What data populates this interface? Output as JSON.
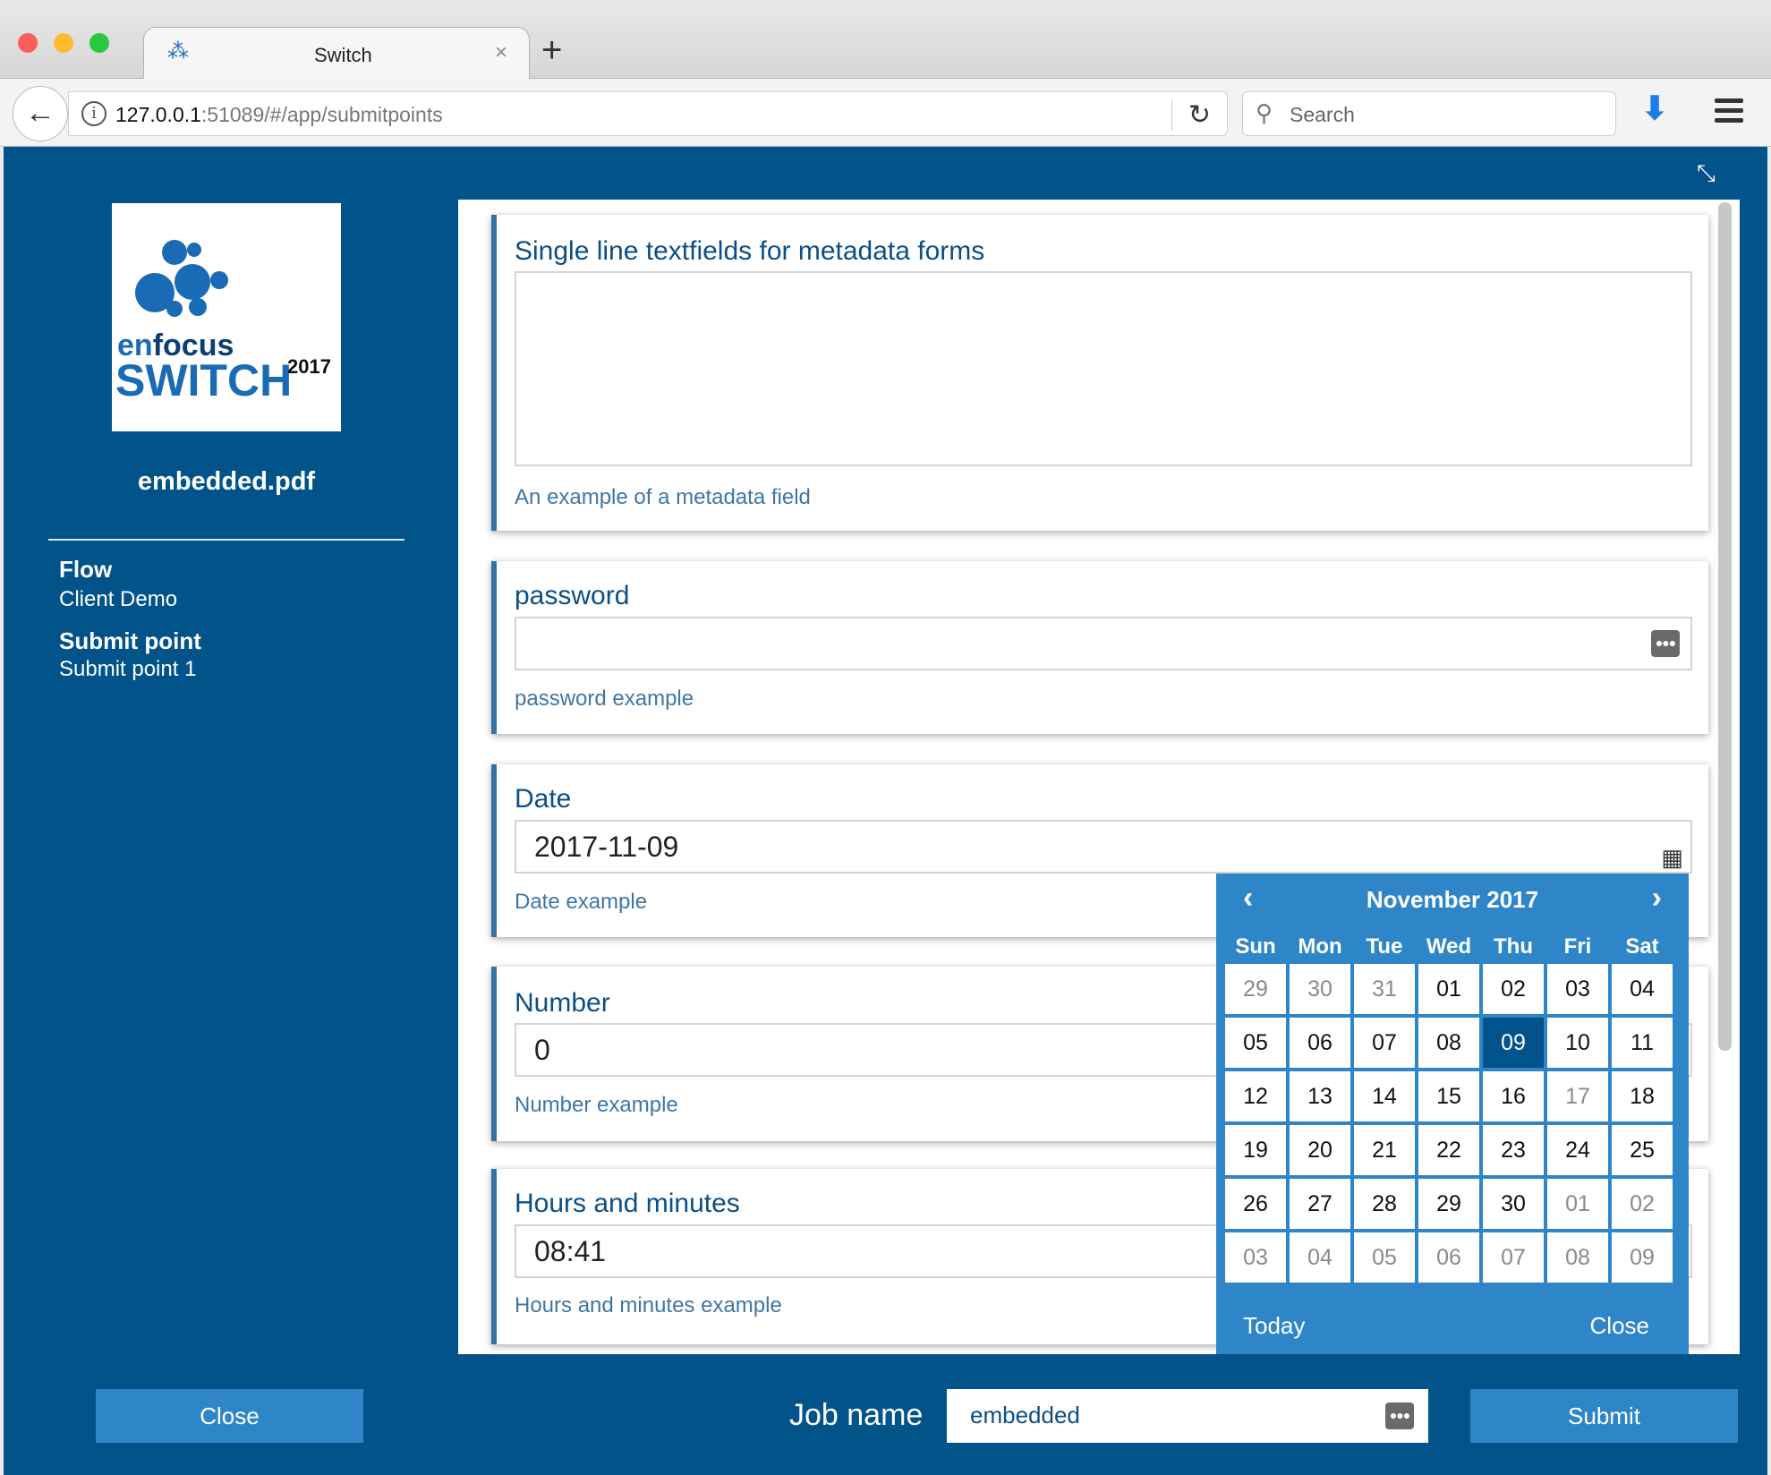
{
  "browser": {
    "tab_title": "Switch",
    "url_host": "127.0.0.1",
    "url_rest": ":51089/#/app/submitpoints",
    "search_placeholder": "Search"
  },
  "sidebar": {
    "file_name": "embedded.pdf",
    "flow_label": "Flow",
    "flow_value": "Client Demo",
    "submit_label": "Submit point",
    "submit_value": "Submit point 1",
    "logo_text": "enfocus SWITCH 2017"
  },
  "fields": [
    {
      "label": "Single line textfields for metadata forms",
      "value": "",
      "help": "An example of a metadata field"
    },
    {
      "label": "password",
      "value": "",
      "help": "password example"
    },
    {
      "label": "Date",
      "value": "2017-11-09",
      "help": "Date example"
    },
    {
      "label": "Number",
      "value": "0",
      "help": "Number example"
    },
    {
      "label": "Hours and minutes",
      "value": "08:41",
      "help": "Hours and minutes example"
    }
  ],
  "calendar": {
    "title": "November 2017",
    "weekdays": [
      "Sun",
      "Mon",
      "Tue",
      "Wed",
      "Thu",
      "Fri",
      "Sat"
    ],
    "days": [
      [
        "29",
        1
      ],
      [
        "30",
        1
      ],
      [
        "31",
        1
      ],
      [
        "01",
        0
      ],
      [
        "02",
        0
      ],
      [
        "03",
        0
      ],
      [
        "04",
        0
      ],
      [
        "05",
        0
      ],
      [
        "06",
        0
      ],
      [
        "07",
        0
      ],
      [
        "08",
        0
      ],
      [
        "09",
        2
      ],
      [
        "10",
        0
      ],
      [
        "11",
        0
      ],
      [
        "12",
        0
      ],
      [
        "13",
        0
      ],
      [
        "14",
        0
      ],
      [
        "15",
        0
      ],
      [
        "16",
        0
      ],
      [
        "17",
        1
      ],
      [
        "18",
        0
      ],
      [
        "19",
        0
      ],
      [
        "20",
        0
      ],
      [
        "21",
        0
      ],
      [
        "22",
        0
      ],
      [
        "23",
        0
      ],
      [
        "24",
        0
      ],
      [
        "25",
        0
      ],
      [
        "26",
        0
      ],
      [
        "27",
        0
      ],
      [
        "28",
        0
      ],
      [
        "29",
        0
      ],
      [
        "30",
        0
      ],
      [
        "01",
        1
      ],
      [
        "02",
        1
      ],
      [
        "03",
        1
      ],
      [
        "04",
        1
      ],
      [
        "05",
        1
      ],
      [
        "06",
        1
      ],
      [
        "07",
        1
      ],
      [
        "08",
        1
      ],
      [
        "09",
        1
      ]
    ],
    "today": "Today",
    "close": "Close"
  },
  "footer": {
    "close": "Close",
    "job_label": "Job name",
    "job_value": "embedded",
    "submit": "Submit"
  },
  "colors": {
    "app_bg": "#01538a",
    "accent": "#2e86c8",
    "selected": "#02528c"
  }
}
